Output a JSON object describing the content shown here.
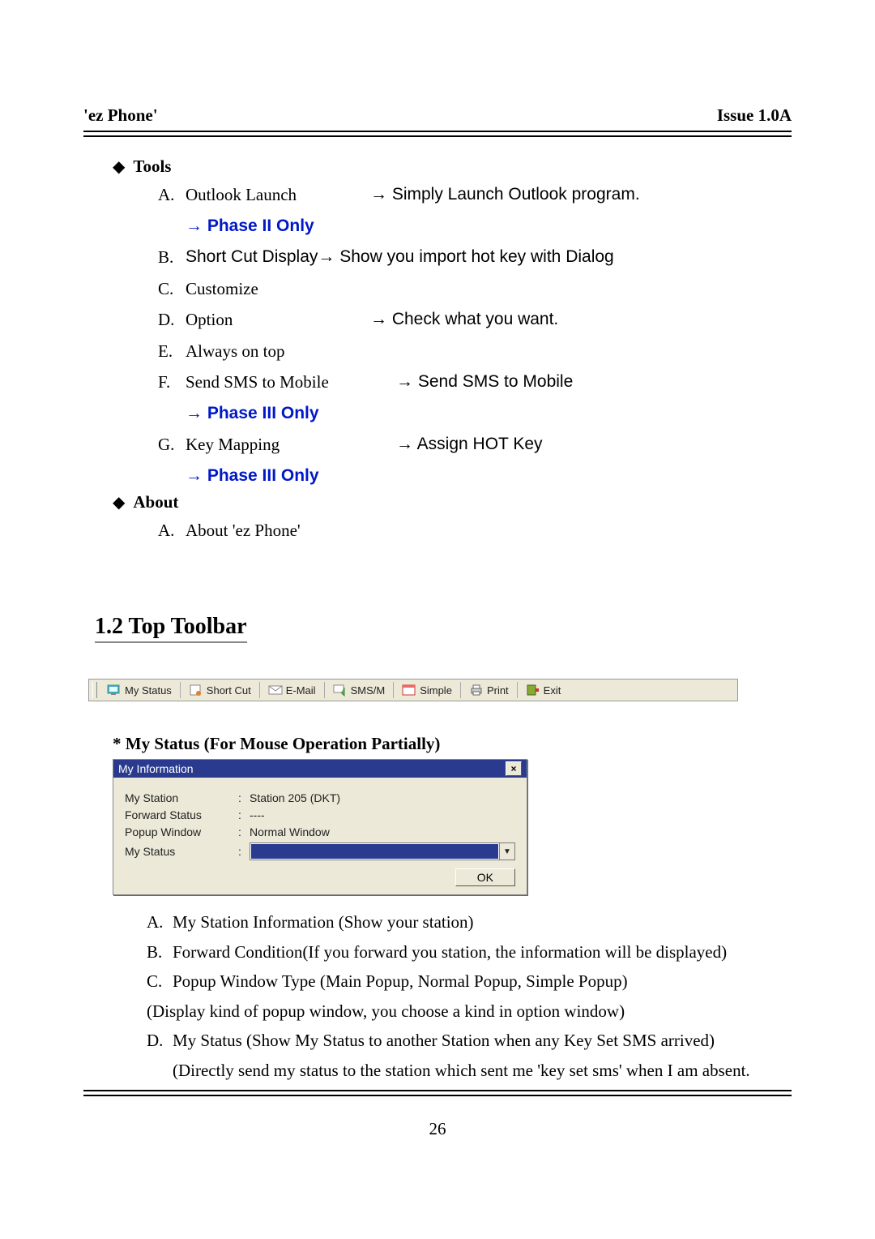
{
  "header": {
    "left": "'ez Phone'",
    "right": "Issue 1.0A"
  },
  "sections": {
    "tools": {
      "label": "Tools",
      "items": {
        "A": {
          "letter": "A.",
          "name": "Outlook Launch",
          "desc": "→ Simply Launch Outlook program.",
          "phase": "→ Phase II Only"
        },
        "B": {
          "letter": "B.",
          "text": "Short Cut Display→ Show you import hot key with Dialog"
        },
        "C": {
          "letter": "C.",
          "name": "Customize"
        },
        "D": {
          "letter": "D.",
          "name": "Option",
          "desc": "→ Check what you want."
        },
        "E": {
          "letter": "E.",
          "name": "Always on top"
        },
        "F": {
          "letter": "F.",
          "name": "Send SMS to Mobile",
          "desc": "→ Send SMS to Mobile",
          "phase": "→ Phase III Only"
        },
        "G": {
          "letter": "G.",
          "name": "Key Mapping",
          "desc": "→ Assign HOT Key",
          "phase": "→ Phase III Only"
        }
      }
    },
    "about": {
      "label": "About",
      "items": {
        "A": {
          "letter": "A.",
          "name": "About 'ez Phone'"
        }
      }
    }
  },
  "top_toolbar_heading": "1.2 Top Toolbar",
  "toolbar": {
    "my_status": "My Status",
    "short_cut": "Short Cut",
    "email": "E-Mail",
    "smsm": "SMS/M",
    "simple": "Simple",
    "print": "Print",
    "exit": "Exit"
  },
  "mystatus_heading": "* My Status    (For Mouse Operation Partially)",
  "mywin": {
    "title": "My Information",
    "close": "×",
    "rows": {
      "station": {
        "label": "My Station",
        "value": "Station 205 (DKT)"
      },
      "forward": {
        "label": "Forward Status",
        "value": "----"
      },
      "popup": {
        "label": "Popup Window",
        "value": "Normal Window"
      },
      "status": {
        "label": "My Status",
        "value": ""
      }
    },
    "ok": "OK",
    "colon": ":"
  },
  "lower": {
    "A": {
      "letter": "A.",
      "text": "My Station Information (Show your station)"
    },
    "B": {
      "letter": "B.",
      "text": "Forward Condition(If you forward you station, the information will be displayed)"
    },
    "C": {
      "letter": "C.",
      "text": "Popup Window Type (Main Popup, Normal Popup, Simple Popup)"
    },
    "Cpar": "(Display kind of popup window, you choose a kind in option window)",
    "D": {
      "letter": "D.",
      "text": "My Status (Show My Status to another Station when any Key Set SMS arrived)"
    },
    "Dpar": "(Directly send my status to the station which sent me 'key set sms' when I am absent."
  },
  "pagenum": "26"
}
